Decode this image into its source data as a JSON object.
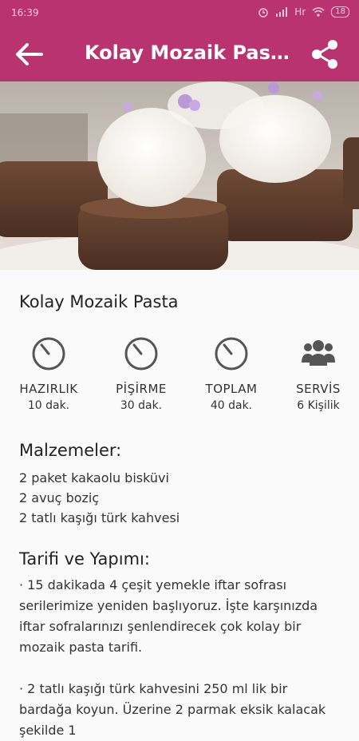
{
  "status_bar": {
    "time": "16:39",
    "network": "Hr",
    "battery": "18"
  },
  "app_bar": {
    "title": "Kolay Mozaik Pasta"
  },
  "recipe": {
    "title": "Kolay Mozaik Pasta",
    "stats": [
      {
        "label": "HAZIRLIK",
        "value": "10 dak.",
        "icon": "timer-icon"
      },
      {
        "label": "PİŞİRME",
        "value": "30 dak.",
        "icon": "timer-icon"
      },
      {
        "label": "TOPLAM",
        "value": "40 dak.",
        "icon": "timer-icon"
      },
      {
        "label": "SERVİS",
        "value": "6 Kişilik",
        "icon": "people-icon"
      }
    ],
    "ingredients_title": "Malzemeler:",
    "ingredients": [
      "2 paket kakaolu bisküvi",
      "2 avuç boziç",
      "2 tatlı kaşığı türk kahvesi"
    ],
    "steps_title": "Tarifi ve Yapımı:",
    "steps": [
      "· 15 dakikada 4 çeşit yemekle iftar sofrası serilerimize yeniden başlıyoruz. İşte karşınızda iftar sofralarınızı şenlendirecek çok kolay bir mozaik pasta tarifi.",
      "· 2 tatlı kaşığı türk kahvesini 250 ml lik bir bardağa koyun. Üzerine 2 parmak eksik kalacak şekilde 1"
    ]
  },
  "colors": {
    "primary": "#b8336f",
    "icon_gray": "#555555"
  }
}
